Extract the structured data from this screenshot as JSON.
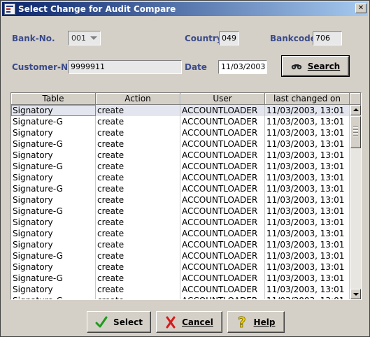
{
  "window": {
    "title": "Select Change for Audit Compare"
  },
  "form": {
    "bank_no_label": "Bank-No.",
    "bank_no_value": "001",
    "country_label": "Country",
    "country_value": "049",
    "bankcode_label": "Bankcode",
    "bankcode_value": "706",
    "customer_no_label": "Customer-No",
    "customer_no_value": "9999911",
    "date_label": "Date",
    "date_value": "11/03/2003"
  },
  "buttons": {
    "search_label": "Search",
    "select_label": "Select",
    "cancel_label": "Cancel",
    "help_label": "Help"
  },
  "table": {
    "columns": [
      "Table",
      "Action",
      "User",
      "last changed on"
    ],
    "rows": [
      [
        "Signatory",
        "create",
        "ACCOUNTLOADER",
        "11/03/2003, 13:01"
      ],
      [
        "Signature-G",
        "create",
        "ACCOUNTLOADER",
        "11/03/2003, 13:01"
      ],
      [
        "Signatory",
        "create",
        "ACCOUNTLOADER",
        "11/03/2003, 13:01"
      ],
      [
        "Signature-G",
        "create",
        "ACCOUNTLOADER",
        "11/03/2003, 13:01"
      ],
      [
        "Signatory",
        "create",
        "ACCOUNTLOADER",
        "11/03/2003, 13:01"
      ],
      [
        "Signature-G",
        "create",
        "ACCOUNTLOADER",
        "11/03/2003, 13:01"
      ],
      [
        "Signatory",
        "create",
        "ACCOUNTLOADER",
        "11/03/2003, 13:01"
      ],
      [
        "Signature-G",
        "create",
        "ACCOUNTLOADER",
        "11/03/2003, 13:01"
      ],
      [
        "Signatory",
        "create",
        "ACCOUNTLOADER",
        "11/03/2003, 13:01"
      ],
      [
        "Signature-G",
        "create",
        "ACCOUNTLOADER",
        "11/03/2003, 13:01"
      ],
      [
        "Signatory",
        "create",
        "ACCOUNTLOADER",
        "11/03/2003, 13:01"
      ],
      [
        "Signatory",
        "create",
        "ACCOUNTLOADER",
        "11/03/2003, 13:01"
      ],
      [
        "Signatory",
        "create",
        "ACCOUNTLOADER",
        "11/03/2003, 13:01"
      ],
      [
        "Signature-G",
        "create",
        "ACCOUNTLOADER",
        "11/03/2003, 13:01"
      ],
      [
        "Signatory",
        "create",
        "ACCOUNTLOADER",
        "11/03/2003, 13:01"
      ],
      [
        "Signature-G",
        "create",
        "ACCOUNTLOADER",
        "11/03/2003, 13:01"
      ],
      [
        "Signatory",
        "create",
        "ACCOUNTLOADER",
        "11/03/2003, 13:01"
      ],
      [
        "Signature-G",
        "create",
        "ACCOUNTLOADER",
        "11/03/2003, 13:01"
      ]
    ],
    "selected_row": 0
  },
  "icons": {
    "app": "app-logo-icon",
    "search": "binoculars-icon",
    "select": "checkmark-icon",
    "cancel": "x-mark-icon",
    "help": "question-mark-icon"
  },
  "colors": {
    "label": "#3b4b8a",
    "title_start": "#0a246a",
    "title_end": "#a6caf0",
    "check": "#1e9a1e",
    "cancel": "#d41c1c",
    "help": "#f0d000"
  }
}
